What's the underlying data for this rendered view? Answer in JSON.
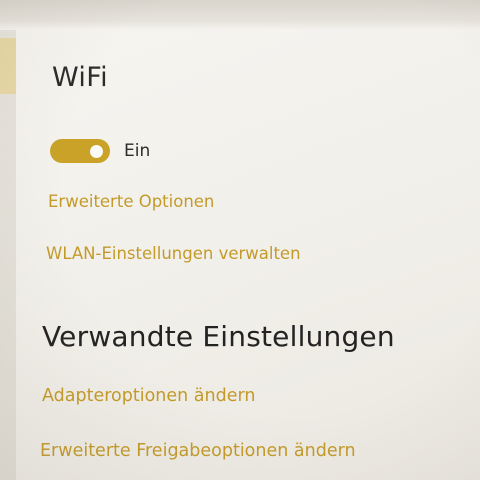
{
  "wifi": {
    "title": "WiFi",
    "toggle_state_label": "Ein",
    "toggle_on": true,
    "links": {
      "advanced_options": "Erweiterte Optionen",
      "manage_wlan": "WLAN-Einstellungen verwalten"
    }
  },
  "related": {
    "heading": "Verwandte Einstellungen",
    "links": {
      "adapter_options": "Adapteroptionen ändern",
      "sharing_options": "Erweiterte Freigabeoptionen ändern"
    }
  },
  "colors": {
    "accent": "#c9a227",
    "link": "#c39a2a",
    "text": "#2c2c2c",
    "background": "#f3f1ec",
    "nav_indicator": "#e8d8a6"
  }
}
